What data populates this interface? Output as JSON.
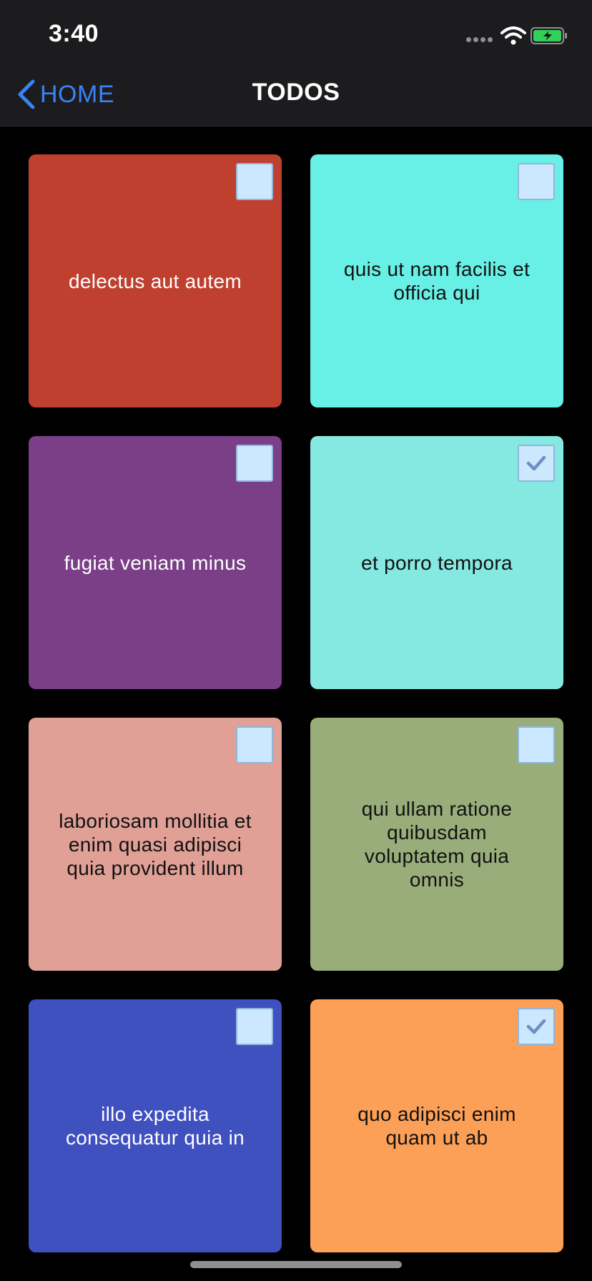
{
  "status_bar": {
    "time": "3:40",
    "battery_color": "#30d158"
  },
  "nav": {
    "back_label": "HOME",
    "title": "TODOS",
    "accent_color": "#3a82f7"
  },
  "todos": [
    {
      "title": "delectus aut autem",
      "completed": false,
      "color": "#c0402f",
      "text_color": "#ffffff"
    },
    {
      "title": "quis ut nam facilis et officia qui",
      "completed": false,
      "color": "#69f0e6",
      "text_color": "#111111"
    },
    {
      "title": "fugiat veniam minus",
      "completed": false,
      "color": "#7a3f87",
      "text_color": "#ffffff"
    },
    {
      "title": "et porro tempora",
      "completed": true,
      "color": "#85e8e1",
      "text_color": "#111111"
    },
    {
      "title": "laboriosam mollitia et enim quasi adipisci quia provident illum",
      "completed": false,
      "color": "#e0a096",
      "text_color": "#111111"
    },
    {
      "title": "qui ullam ratione quibusdam voluptatem quia omnis",
      "completed": false,
      "color": "#99ad7a",
      "text_color": "#111111"
    },
    {
      "title": "illo expedita consequatur quia in",
      "completed": false,
      "color": "#3f50bf",
      "text_color": "#ffffff"
    },
    {
      "title": "quo adipisci enim quam ut ab",
      "completed": true,
      "color": "#fc9f57",
      "text_color": "#111111"
    }
  ],
  "icons": {
    "back": "chevron-left-icon",
    "check": "checkmark-icon",
    "signal": "cellular-signal-icon",
    "wifi": "wifi-icon",
    "battery": "battery-charging-icon"
  }
}
